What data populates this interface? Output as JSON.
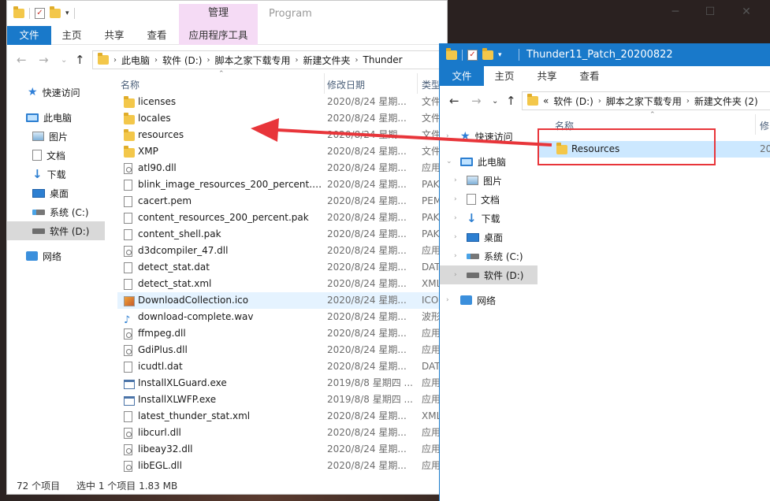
{
  "window1": {
    "manage_label": "管理",
    "program_label": "Program",
    "ribbon_tabs": [
      "文件",
      "主页",
      "共享",
      "查看",
      "应用程序工具"
    ],
    "breadcrumbs": [
      "此电脑",
      "软件 (D:)",
      "脚本之家下载专用",
      "新建文件夹",
      "Thunder"
    ],
    "nav": [
      {
        "label": "快速访问",
        "icon": "star-icon"
      },
      {
        "label": "此电脑",
        "icon": "computer-icon"
      },
      {
        "label": "图片",
        "icon": "pictures-icon"
      },
      {
        "label": "文档",
        "icon": "documents-icon"
      },
      {
        "label": "下载",
        "icon": "download-icon"
      },
      {
        "label": "桌面",
        "icon": "desktop-icon"
      },
      {
        "label": "系统 (C:)",
        "icon": "drive-icon"
      },
      {
        "label": "软件 (D:)",
        "icon": "drive-icon"
      },
      {
        "label": "网络",
        "icon": "network-icon"
      }
    ],
    "columns": {
      "name": "名称",
      "date": "修改日期",
      "type": "类型"
    },
    "files": [
      {
        "name": "licenses",
        "date": "2020/8/24 星期...",
        "type": "文件",
        "icon": "folder"
      },
      {
        "name": "locales",
        "date": "2020/8/24 星期...",
        "type": "文件",
        "icon": "folder"
      },
      {
        "name": "resources",
        "date": "2020/8/24 星期...",
        "type": "文件",
        "icon": "folder"
      },
      {
        "name": "XMP",
        "date": "2020/8/24 星期...",
        "type": "文件",
        "icon": "folder"
      },
      {
        "name": "atl90.dll",
        "date": "2020/8/24 星期...",
        "type": "应用",
        "icon": "gear"
      },
      {
        "name": "blink_image_resources_200_percent.p...",
        "date": "2020/8/24 星期...",
        "type": "PAK",
        "icon": "file"
      },
      {
        "name": "cacert.pem",
        "date": "2020/8/24 星期...",
        "type": "PEM",
        "icon": "file"
      },
      {
        "name": "content_resources_200_percent.pak",
        "date": "2020/8/24 星期...",
        "type": "PAK",
        "icon": "file"
      },
      {
        "name": "content_shell.pak",
        "date": "2020/8/24 星期...",
        "type": "PAK",
        "icon": "file"
      },
      {
        "name": "d3dcompiler_47.dll",
        "date": "2020/8/24 星期...",
        "type": "应用",
        "icon": "gear"
      },
      {
        "name": "detect_stat.dat",
        "date": "2020/8/24 星期...",
        "type": "DAT",
        "icon": "file"
      },
      {
        "name": "detect_stat.xml",
        "date": "2020/8/24 星期...",
        "type": "XML",
        "icon": "file"
      },
      {
        "name": "DownloadCollection.ico",
        "date": "2020/8/24 星期...",
        "type": "ICO",
        "icon": "ico"
      },
      {
        "name": "download-complete.wav",
        "date": "2020/8/24 星期...",
        "type": "波形",
        "icon": "wav"
      },
      {
        "name": "ffmpeg.dll",
        "date": "2020/8/24 星期...",
        "type": "应用",
        "icon": "gear"
      },
      {
        "name": "GdiPlus.dll",
        "date": "2020/8/24 星期...",
        "type": "应用",
        "icon": "gear"
      },
      {
        "name": "icudtl.dat",
        "date": "2020/8/24 星期...",
        "type": "DAT",
        "icon": "file"
      },
      {
        "name": "InstallXLGuard.exe",
        "date": "2019/8/8 星期四 ...",
        "type": "应用",
        "icon": "exe"
      },
      {
        "name": "InstallXLWFP.exe",
        "date": "2019/8/8 星期四 ...",
        "type": "应用",
        "icon": "exe"
      },
      {
        "name": "latest_thunder_stat.xml",
        "date": "2020/8/24 星期...",
        "type": "XML",
        "icon": "file"
      },
      {
        "name": "libcurl.dll",
        "date": "2020/8/24 星期...",
        "type": "应用",
        "icon": "gear"
      },
      {
        "name": "libeay32.dll",
        "date": "2020/8/24 星期...",
        "type": "应用",
        "icon": "gear"
      },
      {
        "name": "libEGL.dll",
        "date": "2020/8/24 星期...",
        "type": "应用",
        "icon": "gear"
      }
    ],
    "status_count": "72 个项目",
    "status_selected": "选中 1 个项目  1.83 MB"
  },
  "window2": {
    "title": "Thunder11_Patch_20200822",
    "ribbon_tabs": [
      "文件",
      "主页",
      "共享",
      "查看"
    ],
    "breadcrumbs": [
      "«",
      "软件 (D:)",
      "脚本之家下载专用",
      "新建文件夹 (2)"
    ],
    "nav": [
      {
        "label": "快速访问",
        "icon": "star-icon"
      },
      {
        "label": "此电脑",
        "icon": "computer-icon"
      },
      {
        "label": "图片",
        "icon": "pictures-icon"
      },
      {
        "label": "文档",
        "icon": "documents-icon"
      },
      {
        "label": "下载",
        "icon": "download-icon"
      },
      {
        "label": "桌面",
        "icon": "desktop-icon"
      },
      {
        "label": "系统 (C:)",
        "icon": "drive-icon"
      },
      {
        "label": "软件 (D:)",
        "icon": "drive-icon"
      },
      {
        "label": "网络",
        "icon": "network-icon"
      }
    ],
    "columns": {
      "name": "名称",
      "date": "修"
    },
    "files": [
      {
        "name": "Resources",
        "date": "20"
      }
    ]
  },
  "colors": {
    "accent": "#1979ca",
    "manage_tab": "#f5dbf5",
    "highlight_box": "#e8353a",
    "selection": "#cce8ff"
  }
}
